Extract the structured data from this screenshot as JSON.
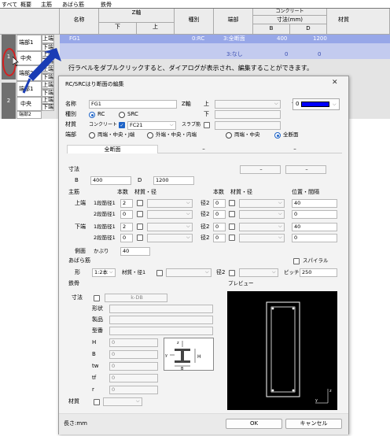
{
  "sheet_tabs": [
    "すべて",
    "概要",
    "主筋",
    "あばら筋",
    "鉄骨"
  ],
  "grid": {
    "headers": {
      "name": "名称",
      "z_axis": "Z軸",
      "z_lower": "下",
      "z_upper": "上",
      "type": "種別",
      "end": "端部",
      "concrete": "コンクリート",
      "size_mm": "寸法(mm)",
      "b": "B",
      "d": "D",
      "material": "材質"
    },
    "row_numbers": [
      "1",
      "2"
    ],
    "end_labels": [
      "端部1",
      "中央",
      "端部2",
      "端部1",
      "中央",
      "端部2"
    ],
    "side_labels": [
      "上端",
      "下端",
      "上端",
      "下端",
      "上端",
      "下端",
      "上端",
      "下端",
      "上端",
      "下端"
    ],
    "row1": {
      "name": "FG1",
      "type": "0:RC",
      "end": "3:全断面",
      "b": "400",
      "d": "1200"
    },
    "row2": {
      "end": "3:なし",
      "b": "0",
      "d": "0"
    }
  },
  "annotation": "行ラベルをダブルクリックすると、ダイアログが表示され、編集することができます。",
  "dialog": {
    "title": "RC/SRCはり断面の編集",
    "close": "✕",
    "name_label": "名称",
    "name_value": "FG1",
    "z_label": "Z軸",
    "z_upper": "上",
    "z_lower": "下",
    "color_label": "色",
    "color_index": "0",
    "color_hex": "#0000ff",
    "type_label": "種別",
    "type_rc": "RC",
    "type_src": "SRC",
    "material_label": "材質",
    "material_kind": "コンクリート",
    "material_value": "FC21",
    "slab_label": "スラブ筋",
    "end_label": "端部",
    "end_options": [
      "両端・中央・J端",
      "外端・中央・内端",
      "両端・中央",
      "全断面"
    ],
    "section_tabs": [
      "全断面",
      "–",
      "–"
    ],
    "dims_label": "寸法",
    "b_label": "B",
    "b_value": "400",
    "d_label": "D",
    "d_value": "1200",
    "main_label": "主筋",
    "count_header": "本数",
    "mat_dia_header": "材質・径",
    "count_header2": "本数",
    "mat_dia_header2": "材質・径",
    "pos_header": "位置・間隔",
    "upper_label": "上端",
    "lower_label": "下端",
    "layer1": "1段筋径1",
    "layer2": "2段筋径1",
    "dia2": "径2",
    "upper_rows": [
      {
        "n": "2",
        "n2": "0",
        "pos": "40"
      },
      {
        "n": "0",
        "n2": "0",
        "pos": "0"
      }
    ],
    "lower_rows": [
      {
        "n": "2",
        "n2": "0",
        "pos": "40"
      },
      {
        "n": "0",
        "n2": "0",
        "pos": "0"
      }
    ],
    "side_label": "側面",
    "cover_label": "かぶり",
    "cover_value": "40",
    "stirrup_label": "あばら筋",
    "spiral_label": "スパイラル",
    "shape_label": "形",
    "shape_value": "1:2本",
    "mat_dia1_label": "材質・径1",
    "pitch_label": "ピッチ",
    "pitch_value": "250",
    "steel_label": "鉄骨",
    "preview_label": "プレビュー",
    "kdb_label": "k-DB",
    "steel_fields": [
      "形状",
      "製品",
      "型番"
    ],
    "steel_dims": [
      {
        "k": "H",
        "v": "0"
      },
      {
        "k": "B",
        "v": "0"
      },
      {
        "k": "tw",
        "v": "0"
      },
      {
        "k": "tf",
        "v": "0"
      },
      {
        "k": "r",
        "v": "0"
      }
    ],
    "length_label": "長さ:mm",
    "ok": "OK",
    "cancel": "キャンセル"
  }
}
